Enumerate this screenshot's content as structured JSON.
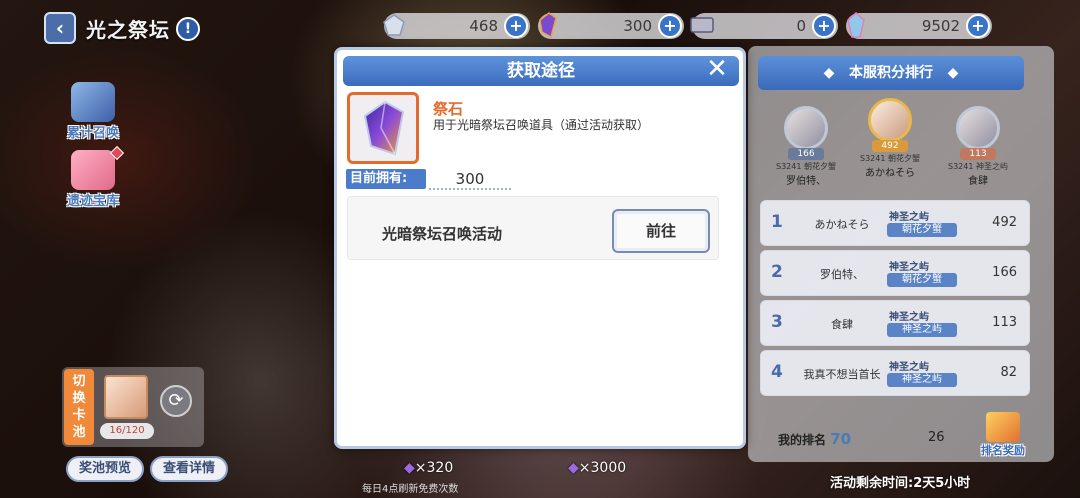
{
  "header": {
    "title": "光之祭坛",
    "resources": [
      {
        "icon": "gem-crystal-icon",
        "value": "468"
      },
      {
        "icon": "altar-stone-icon",
        "value": "300"
      },
      {
        "icon": "ticket-icon",
        "value": "0"
      },
      {
        "icon": "jewel-icon",
        "value": "9502"
      }
    ]
  },
  "sidebar": {
    "cumulative_label": "累计召唤",
    "treasury_label": "遗迹宝库"
  },
  "pool": {
    "switch_label": [
      "切",
      "换",
      "卡",
      "池"
    ],
    "count": "16/120",
    "preview_label": "奖池预览",
    "details_label": "查看详情"
  },
  "bottom": {
    "cost_left": "×320",
    "cost_right": "×3000",
    "refresh_note": "每日4点刷新免费次数"
  },
  "ranking": {
    "title": "本服积分排行",
    "podium": [
      {
        "points": "166",
        "server": "S3241 朝花夕蟹",
        "name": "罗伯特、"
      },
      {
        "points": "492",
        "server": "S3241 朝花夕蟹",
        "name": "あかねそら"
      },
      {
        "points": "113",
        "server": "S3241 神圣之屿",
        "name": "食肆"
      }
    ],
    "rows": [
      {
        "rank": "1",
        "name": "あかねそら",
        "guild": "神圣之屿",
        "sub": "朝花夕蟹",
        "score": "492"
      },
      {
        "rank": "2",
        "name": "罗伯特、",
        "guild": "神圣之屿",
        "sub": "朝花夕蟹",
        "score": "166"
      },
      {
        "rank": "3",
        "name": "食肆",
        "guild": "神圣之屿",
        "sub": "神圣之屿",
        "score": "113"
      },
      {
        "rank": "4",
        "name": "我真不想当首长",
        "guild": "神圣之屿",
        "sub": "神圣之屿",
        "score": "82"
      }
    ],
    "my_rank_label": "我的排名",
    "my_rank_value": "70",
    "my_score": "26",
    "reward_label": "排名奖励",
    "time_left": "活动剩余时间:2天5小时"
  },
  "modal": {
    "title": "获取途径",
    "item_name": "祭石",
    "item_desc": "用于光暗祭坛召唤道具（通过活动获取）",
    "owned_label": "目前拥有:",
    "owned_value": "300",
    "route_name": "光暗祭坛召唤活动",
    "go_label": "前往"
  }
}
